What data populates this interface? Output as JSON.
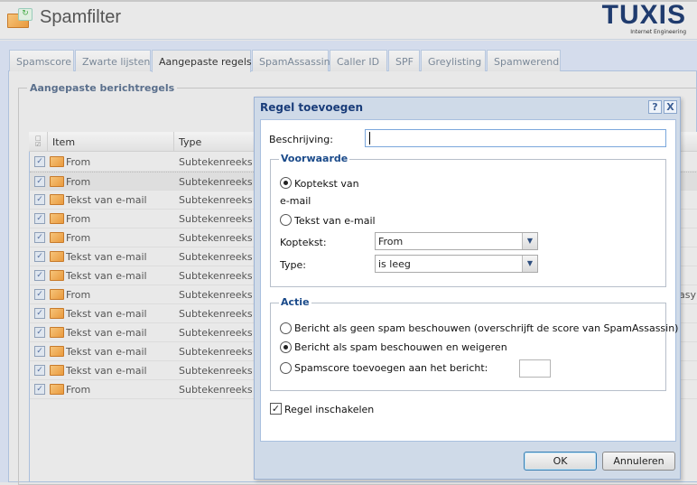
{
  "header": {
    "title": "Spamfilter",
    "logo_text": "TUXIS",
    "logo_sub": "Internet Engineering"
  },
  "tabs": [
    {
      "label": "Spamscore"
    },
    {
      "label": "Zwarte lijsten"
    },
    {
      "label": "Aangepaste regels",
      "active": true
    },
    {
      "label": "SpamAssassin"
    },
    {
      "label": "Caller ID"
    },
    {
      "label": "SPF"
    },
    {
      "label": "Greylisting"
    },
    {
      "label": "Spamwerend"
    }
  ],
  "panel": {
    "legend": "Aangepaste berichtregels"
  },
  "grid": {
    "columns": [
      "Item",
      "Type"
    ],
    "rows": [
      {
        "item": "From",
        "type": "Subtekenreeks",
        "checked": true
      },
      {
        "item": "From",
        "type": "Subtekenreeks",
        "checked": true
      },
      {
        "item": "Tekst van e-mail",
        "type": "Subtekenreeks",
        "checked": true
      },
      {
        "item": "From",
        "type": "Subtekenreeks",
        "checked": true
      },
      {
        "item": "From",
        "type": "Subtekenreeks",
        "checked": true
      },
      {
        "item": "Tekst van e-mail",
        "type": "Subtekenreeks",
        "checked": true
      },
      {
        "item": "Tekst van e-mail",
        "type": "Subtekenreeks",
        "checked": true
      },
      {
        "item": "From",
        "type": "Subtekenreeks",
        "checked": true
      },
      {
        "item": "Tekst van e-mail",
        "type": "Subtekenreeks",
        "checked": true
      },
      {
        "item": "Tekst van e-mail",
        "type": "Subtekenreeks",
        "checked": true
      },
      {
        "item": "Tekst van e-mail",
        "type": "Subtekenreeks",
        "checked": true
      },
      {
        "item": "Tekst van e-mail",
        "type": "Subtekenreeks",
        "checked": true
      },
      {
        "item": "From",
        "type": "Subtekenreeks",
        "checked": true
      }
    ],
    "clipped_text": "asy"
  },
  "dialog": {
    "title": "Regel toevoegen",
    "help": "?",
    "close": "X",
    "description_label": "Beschrijving:",
    "description_value": "",
    "condition": {
      "legend": "Voorwaarde",
      "radio_header_line1": "Koptekst van",
      "radio_header_line2": "e-mail",
      "radio_body": "Tekst van e-mail",
      "selected": "header",
      "header_label": "Koptekst:",
      "header_value": "From",
      "type_label": "Type:",
      "type_value": "is leeg"
    },
    "action": {
      "legend": "Actie",
      "opt_nospam": "Bericht als geen spam beschouwen (overschrijft de score van SpamAssassin)",
      "opt_spam": "Bericht als spam beschouwen en weigeren",
      "opt_score": "Spamscore toevoegen aan het bericht:",
      "selected": "spam",
      "score_value": ""
    },
    "enable_label": "Regel inschakelen",
    "enable_checked": true,
    "ok": "OK",
    "cancel": "Annuleren"
  }
}
